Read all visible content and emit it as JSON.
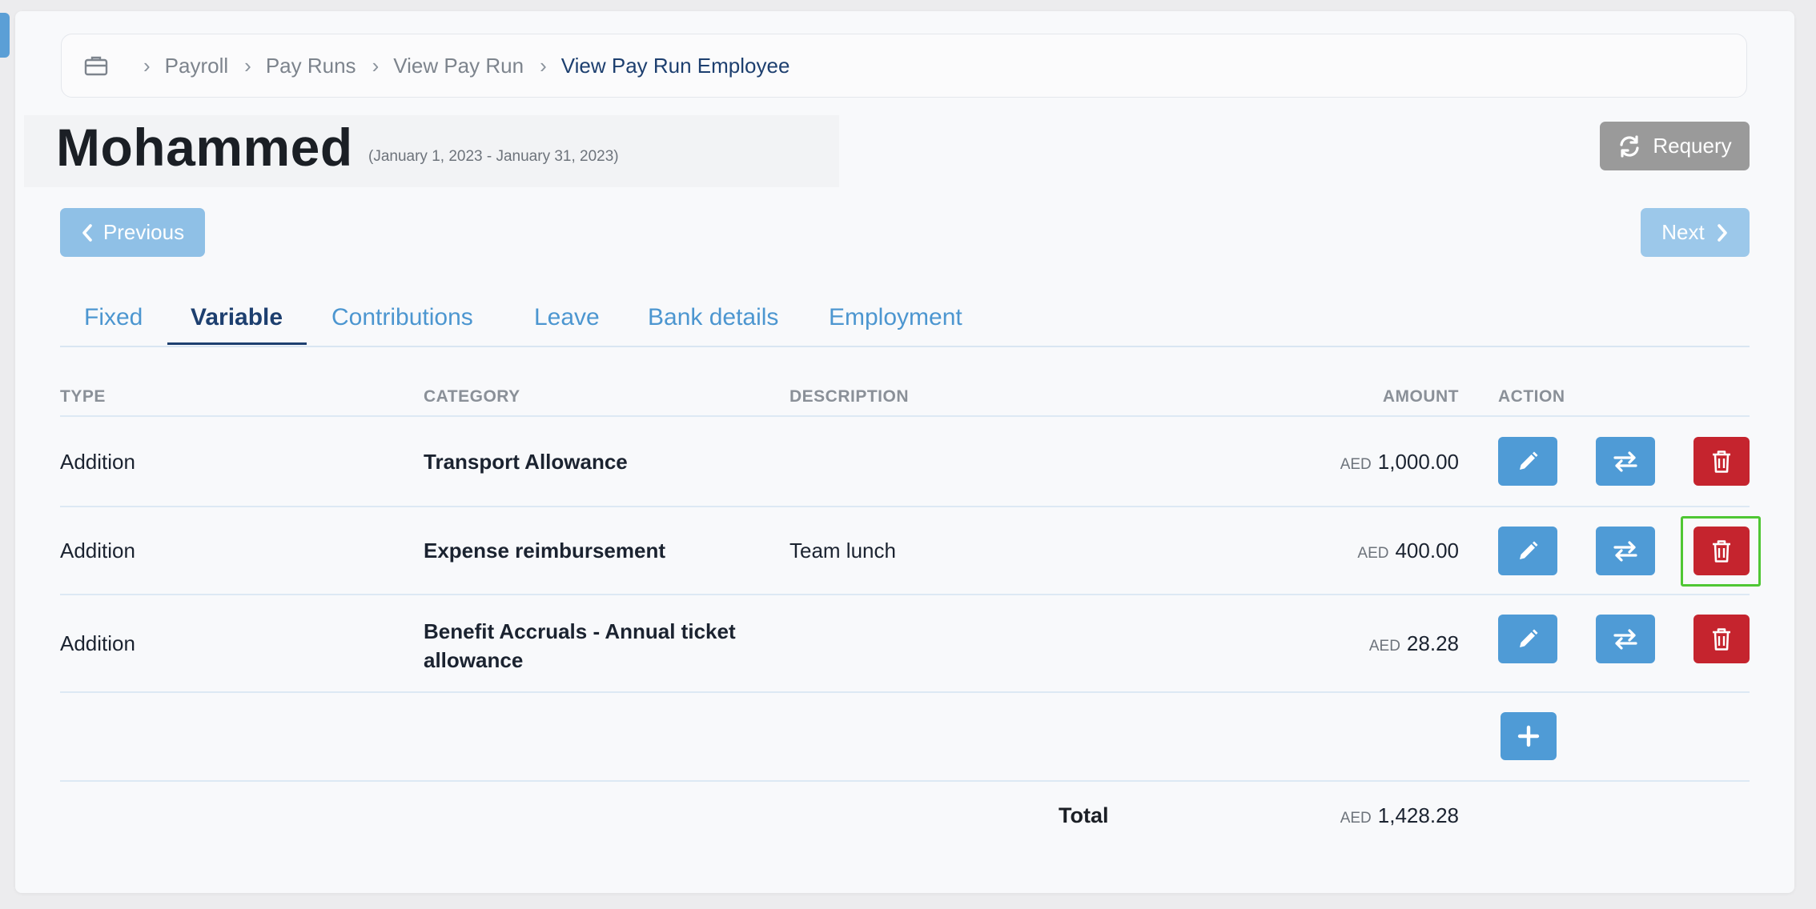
{
  "breadcrumb": {
    "home_icon": "briefcase-icon",
    "items": [
      "Payroll",
      "Pay Runs",
      "View Pay Run",
      "View Pay Run Employee"
    ]
  },
  "employee": {
    "name": "Mohammed",
    "period": "(January 1, 2023 - January 31, 2023)"
  },
  "buttons": {
    "requery": "Requery",
    "previous": "Previous",
    "next": "Next"
  },
  "tabs": [
    "Fixed",
    "Variable",
    "Contributions",
    "Leave",
    "Bank details",
    "Employment"
  ],
  "active_tab": "Variable",
  "table": {
    "headers": {
      "type": "TYPE",
      "category": "CATEGORY",
      "description": "DESCRIPTION",
      "amount": "AMOUNT",
      "action": "ACTION"
    },
    "rows": [
      {
        "type": "Addition",
        "category": "Transport Allowance",
        "description": "",
        "currency": "AED",
        "amount": "1,000.00"
      },
      {
        "type": "Addition",
        "category": "Expense reimbursement",
        "description": "Team lunch",
        "currency": "AED",
        "amount": "400.00"
      },
      {
        "type": "Addition",
        "category": "Benefit Accruals - Annual ticket allowance",
        "description": "",
        "currency": "AED",
        "amount": "28.28"
      }
    ],
    "total_label": "Total",
    "total_currency": "AED",
    "total_amount": "1,428.28"
  },
  "colors": {
    "primary": "#4f9bd6",
    "danger": "#c5242e",
    "requery": "#9a9a9a",
    "nav_disabled": "#8fc0e6",
    "active_tab": "#1d3f6f",
    "highlight": "#4fc734"
  },
  "icons": {
    "requery": "refresh-icon",
    "previous": "chevron-left-icon",
    "next": "chevron-right-icon",
    "edit": "pencil-icon",
    "transfer": "swap-arrows-icon",
    "delete": "trash-icon",
    "add": "plus-icon"
  }
}
